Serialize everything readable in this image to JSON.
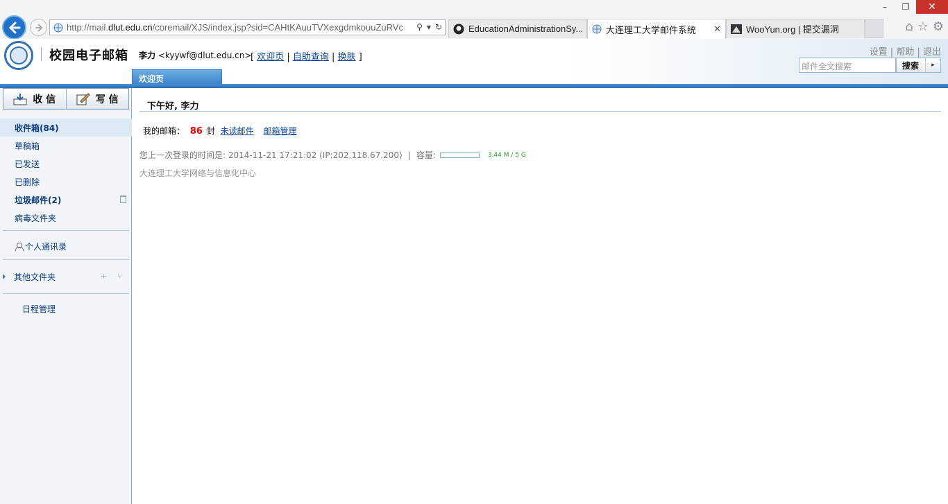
{
  "browser": {
    "url_prefix": "http://mail.",
    "url_domain": "dlut.edu.cn",
    "url_rest": "/coremail/XJS/index.jsp?sid=CAHtKAuuTVXexgdmkouuZuRVc",
    "tabs": [
      {
        "label": "EducationAdministrationSy...",
        "icon": "github-icon"
      },
      {
        "label": "大连理工大学邮件系统",
        "icon": "ie-page-icon"
      },
      {
        "label": "WooYun.org | 提交漏洞",
        "icon": "wooyun-icon"
      }
    ],
    "window_controls": {
      "minimize": "–",
      "restore": "❐",
      "close": "✕"
    }
  },
  "header": {
    "brand": "校园电子邮箱",
    "user_name": "李力",
    "user_email": "<kyywf@dlut.edu.cn>",
    "links": {
      "welcome": "欢迎页",
      "self_query": "自助查询",
      "skin": "换肤"
    },
    "util": {
      "settings": "设置",
      "help": "帮助",
      "logout": "退出"
    },
    "search_placeholder": "邮件全文搜索",
    "search_button": "搜索",
    "welcome_tab": "欢迎页"
  },
  "sidebar": {
    "receive": "收 信",
    "compose": "写 信",
    "folders": [
      {
        "label": "收件箱(84)"
      },
      {
        "label": "草稿箱"
      },
      {
        "label": "已发送"
      },
      {
        "label": "已删除"
      },
      {
        "label": "垃圾邮件(2)"
      },
      {
        "label": "病毒文件夹"
      }
    ],
    "contacts": "个人通讯录",
    "other_folders": "其他文件夹",
    "other_ops": "+ ⑂",
    "calendar": "日程管理"
  },
  "main": {
    "greeting": "下午好, 李力",
    "mybox_label": "我的邮箱：",
    "mail_count": "86",
    "mail_unit": "封",
    "unread_link": "未读邮件",
    "manage_link": "邮箱管理",
    "last_login": "您上一次登录的时间是: 2014-11-21 17:21:02 (IP:202.118.67.200)",
    "capacity_label": "容量:",
    "quota_text": "3.44 M / 5 G",
    "quota_fraction": 0.0007,
    "org": "大连理工大学网络与信息化中心"
  },
  "colors": {
    "accent": "#2f6fb1",
    "count_red": "#ee0000",
    "link": "#0a47a5"
  }
}
